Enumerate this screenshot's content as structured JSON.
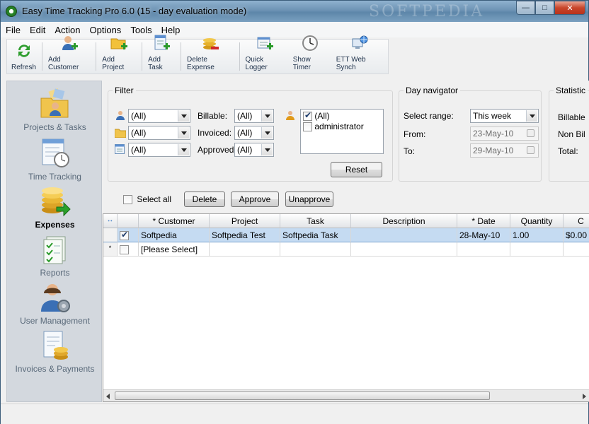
{
  "window": {
    "title": "Easy Time Tracking Pro 6.0 (15 - day evaluation mode)",
    "watermark": "SOFTPEDIA"
  },
  "menu": [
    "File",
    "Edit",
    "Action",
    "Options",
    "Tools",
    "Help"
  ],
  "toolbar": [
    {
      "label": "Refresh",
      "icon": "refresh-icon"
    },
    {
      "label": "Add Customer",
      "icon": "add-customer-icon"
    },
    {
      "label": "Add Project",
      "icon": "add-project-icon"
    },
    {
      "label": "Add Task",
      "icon": "add-task-icon"
    },
    {
      "label": "Delete Expense",
      "icon": "delete-expense-icon"
    },
    {
      "label": "Quick Logger",
      "icon": "quick-logger-icon"
    },
    {
      "label": "Show Timer",
      "icon": "clock-icon"
    },
    {
      "label": "ETT Web Synch",
      "icon": "web-synch-icon"
    }
  ],
  "nav": [
    {
      "label": "Projects & Tasks",
      "icon": "projects-icon",
      "active": false
    },
    {
      "label": "Time Tracking",
      "icon": "time-tracking-icon",
      "active": false
    },
    {
      "label": "Expenses",
      "icon": "expenses-icon",
      "active": true
    },
    {
      "label": "Reports",
      "icon": "reports-icon",
      "active": false
    },
    {
      "label": "User Management",
      "icon": "user-management-icon",
      "active": false
    },
    {
      "label": "Invoices & Payments",
      "icon": "invoices-icon",
      "active": false
    }
  ],
  "filter": {
    "title": "Filter",
    "customer_value": "(All)",
    "project_value": "(All)",
    "task_value": "(All)",
    "billable_label": "Billable:",
    "billable_value": "(All)",
    "invoiced_label": "Invoiced:",
    "invoiced_value": "(All)",
    "approved_label": "Approved:",
    "approved_value": "(All)",
    "users": [
      {
        "label": "(All)",
        "checked": true
      },
      {
        "label": "administrator",
        "checked": false
      }
    ],
    "reset_label": "Reset"
  },
  "day_navigator": {
    "title": "Day navigator",
    "range_label": "Select range:",
    "range_value": "This week",
    "from_label": "From:",
    "from_value": "23-May-10",
    "to_label": "To:",
    "to_value": "29-May-10"
  },
  "statistics": {
    "title": "Statistic",
    "billable_label": "Billable",
    "non_billable_label": "Non Bil",
    "total_label": "Total:"
  },
  "actions": {
    "select_all_label": "Select all",
    "delete_label": "Delete",
    "approve_label": "Approve",
    "unapprove_label": "Unapprove"
  },
  "grid": {
    "columns": [
      "* Customer",
      "Project",
      "Task",
      "Description",
      "* Date",
      "Quantity",
      "C"
    ],
    "rows": [
      {
        "checked": true,
        "cells": [
          "Softpedia",
          "Softpedia Test",
          "Softpedia Task",
          "",
          "28-May-10",
          "1.00",
          "$0.00"
        ]
      },
      {
        "checked": false,
        "cells": [
          "[Please Select]",
          "",
          "",
          "",
          "",
          "",
          ""
        ]
      }
    ]
  },
  "colors": {
    "selected_row": "#c5dbf2",
    "sidebar": "#d3d8de"
  }
}
